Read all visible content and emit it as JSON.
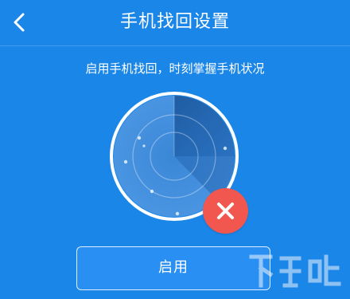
{
  "header": {
    "title": "手机找回设置",
    "back_icon": "chevron-left-icon"
  },
  "subtitle": "启用手机找回，时刻掌握手机状况",
  "radar": {
    "status": "disabled",
    "status_icon": "close-icon",
    "status_color": "#f2574f"
  },
  "enable_button": {
    "label": "启用"
  },
  "colors": {
    "background": "#1a86e8",
    "radar_dark": "#1e5fa8",
    "radar_light": "#4a93e0"
  }
}
